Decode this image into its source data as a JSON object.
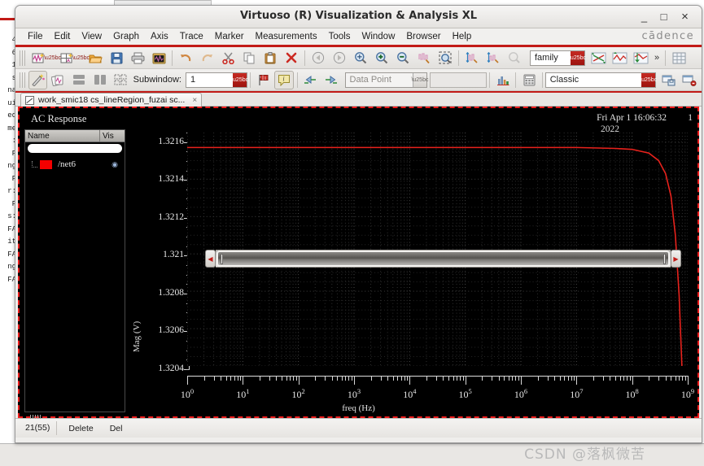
{
  "window": {
    "title": "Virtuoso (R) Visualization & Analysis XL",
    "minimize": "_",
    "maximize": "□",
    "close": "×",
    "brand": "cādence"
  },
  "menubar": {
    "items": [
      {
        "label": "File",
        "mnemonic": "F"
      },
      {
        "label": "Edit",
        "mnemonic": "E"
      },
      {
        "label": "View",
        "mnemonic": "V"
      },
      {
        "label": "Graph",
        "mnemonic": "G"
      },
      {
        "label": "Axis",
        "mnemonic": "A"
      },
      {
        "label": "Trace",
        "mnemonic": "T"
      },
      {
        "label": "Marker",
        "mnemonic": "M"
      },
      {
        "label": "Measurements",
        "mnemonic": "e"
      },
      {
        "label": "Tools",
        "mnemonic": "o"
      },
      {
        "label": "Window",
        "mnemonic": "W"
      },
      {
        "label": "Browser",
        "mnemonic": "B"
      },
      {
        "label": "Help",
        "mnemonic": "H"
      }
    ]
  },
  "toolbar1": {
    "buttons": [
      {
        "name": "new-window",
        "icon": "new-waveform-window"
      },
      {
        "name": "new-window-dropdown",
        "icon": "chevron-down"
      },
      {
        "name": "new-subwindow",
        "icon": "new-subwindow"
      },
      {
        "name": "new-subwindow-dropdown",
        "icon": "chevron-down"
      },
      {
        "name": "open",
        "icon": "folder-open"
      },
      {
        "name": "save",
        "icon": "floppy-save"
      },
      {
        "name": "print",
        "icon": "printer"
      },
      {
        "name": "snapshot",
        "icon": "camera-plot"
      },
      {
        "name": "undo",
        "icon": "undo-arrow"
      },
      {
        "name": "redo",
        "icon": "redo-arrow"
      },
      {
        "name": "cut",
        "icon": "scissors"
      },
      {
        "name": "copy",
        "icon": "copy-pages"
      },
      {
        "name": "paste",
        "icon": "clipboard-paste"
      },
      {
        "name": "delete",
        "icon": "red-x"
      },
      {
        "name": "back",
        "icon": "left-circle-arrow"
      },
      {
        "name": "forward",
        "icon": "right-circle-arrow"
      },
      {
        "name": "zoom-fit",
        "icon": "magnifier-fit"
      },
      {
        "name": "zoom-in",
        "icon": "magnifier-plus"
      },
      {
        "name": "zoom-out",
        "icon": "magnifier-minus"
      },
      {
        "name": "zoom-waveform",
        "icon": "waveform-zoom"
      },
      {
        "name": "zoom-area",
        "icon": "area-select-zoom"
      },
      {
        "name": "vertical-zoom-in",
        "icon": "vertical-zoom-in"
      },
      {
        "name": "vertical-zoom-out",
        "icon": "vertical-zoom-out"
      },
      {
        "name": "zoom-disabled",
        "icon": "magnifier-disabled"
      }
    ],
    "family_combo": {
      "value": "family",
      "name": "family-combo"
    },
    "post_buttons": [
      {
        "name": "swap-axes",
        "icon": "swap-axes"
      },
      {
        "name": "strip-chart",
        "icon": "strip-chart"
      },
      {
        "name": "split-traces",
        "icon": "split-traces"
      }
    ],
    "overflow": "»",
    "grid_button": {
      "name": "grid-toggle",
      "icon": "grid"
    }
  },
  "toolbar2": {
    "buttons": [
      {
        "name": "wand-tool",
        "icon": "magic-wand",
        "pressed": true
      },
      {
        "name": "graph-cards",
        "icon": "cards"
      },
      {
        "name": "stack-horizontal",
        "icon": "stack-rows"
      },
      {
        "name": "stack-vertical",
        "icon": "stack-columns"
      },
      {
        "name": "tile-grid",
        "icon": "tile-grid"
      }
    ],
    "subwindow_label": "Subwindow:",
    "subwindow_value": "1",
    "flag_button": {
      "name": "flag-marker",
      "icon": "red-flag"
    },
    "annotation_button": {
      "name": "annotation-note",
      "icon": "note-balloon",
      "pressed": true
    },
    "prev_marker": {
      "name": "previous-marker",
      "icon": "left-step-arrow"
    },
    "next_marker": {
      "name": "next-marker",
      "icon": "right-step-arrow"
    },
    "datapoint_combo": {
      "value": "Data Point",
      "name": "data-point-combo"
    },
    "datapoint_field_value": "",
    "histogram_button": {
      "name": "histogram",
      "icon": "bar-chart"
    },
    "calculator_button": {
      "name": "calculator",
      "icon": "calculator"
    },
    "style_combo": {
      "value": "Classic",
      "name": "style-combo"
    },
    "style_save": {
      "name": "save-style",
      "icon": "window-save"
    },
    "style_delete": {
      "name": "delete-style",
      "icon": "window-delete"
    }
  },
  "tab": {
    "label": "work_smic18 cs_lineRegion_fuzai sc...",
    "close": "×"
  },
  "plot": {
    "title": "AC Response",
    "date": "Fri Apr 1 16:06:32",
    "year": "2022",
    "index": "1",
    "legend": {
      "col_name": "Name",
      "col_vis": "Vis",
      "search_value": "",
      "rows": [
        {
          "name": "/net6",
          "color": "#f40000",
          "visible": true,
          "eye": "◉"
        }
      ]
    }
  },
  "chart_data": {
    "type": "line",
    "title": "AC Response",
    "xlabel": "freq (Hz)",
    "ylabel": "Mag (V)",
    "xscale": "log",
    "xlim": [
      1,
      1000000000
    ],
    "ylim": [
      1.3204,
      1.32165
    ],
    "xticks": [
      1,
      10,
      100,
      1000,
      10000,
      100000,
      1000000,
      10000000,
      100000000,
      1000000000
    ],
    "xtick_labels": [
      "10⁰",
      "10¹",
      "10²",
      "10³",
      "10⁴",
      "10⁵",
      "10⁶",
      "10⁷",
      "10⁸",
      "10⁹"
    ],
    "xtick_mantissa": [
      "10",
      "10",
      "10",
      "10",
      "10",
      "10",
      "10",
      "10",
      "10",
      "10"
    ],
    "xtick_exponent": [
      "0",
      "1",
      "2",
      "3",
      "4",
      "5",
      "6",
      "7",
      "8",
      "9"
    ],
    "yticks": [
      1.3204,
      1.3206,
      1.3208,
      1.321,
      1.3212,
      1.3214,
      1.3216
    ],
    "ytick_labels": [
      "1.3204",
      "1.3206",
      "1.3208",
      "1.321",
      "1.3212",
      "1.3214",
      "1.3216"
    ],
    "grid": true,
    "legend_position": "left-panel",
    "series": [
      {
        "name": "/net6",
        "color": "#e8221c",
        "x": [
          1,
          10,
          100,
          1000,
          10000,
          100000,
          1000000,
          10000000,
          50000000,
          100000000,
          200000000,
          300000000,
          400000000,
          500000000,
          600000000,
          700000000,
          800000000,
          900000000,
          1000000000
        ],
        "y": [
          1.32157,
          1.32157,
          1.32157,
          1.32157,
          1.32157,
          1.32157,
          1.32157,
          1.32157,
          1.321565,
          1.32156,
          1.32154,
          1.3215,
          1.32143,
          1.32131,
          1.3211,
          1.32078,
          1.32034,
          1.32,
          1.3204
        ]
      }
    ]
  },
  "scrollbar": {
    "left_arrow": "◀",
    "right_arrow": "▶",
    "name": "horizontal-scrollbar"
  },
  "statusbar": {
    "cell1": "21(55)",
    "cell2": "Delete",
    "cell3": "Del"
  },
  "watermark": {
    "prefix": "CSDN @",
    "handle": "落枫微苦"
  },
  "background_app": {
    "lines": [
      "4",
      "6",
      "1",
      "s",
      "na",
      "ui",
      "ed",
      "me",
      "",
      ":",
      "",
      "F",
      "ng",
      "",
      "F",
      "r:",
      "",
      "F",
      "s:",
      "",
      "FA",
      "it",
      "",
      "FA",
      "ng",
      "",
      "FA"
    ]
  },
  "colors": {
    "accent_red": "#c21b17",
    "trace_red": "#e8221c",
    "plot_bg": "#000000",
    "chrome": "#efeeec"
  }
}
